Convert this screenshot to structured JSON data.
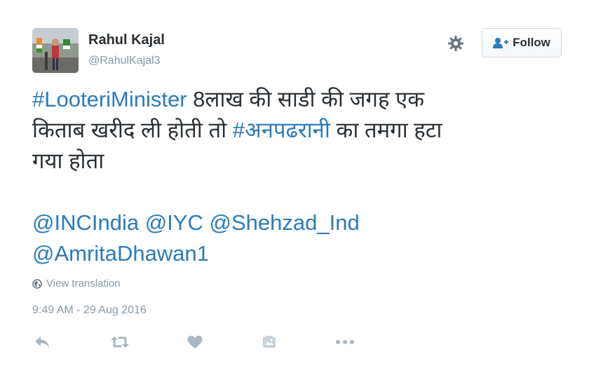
{
  "user": {
    "full_name": "Rahul Kajal",
    "handle": "@RahulKajal3"
  },
  "follow_label": "Follow",
  "tweet": {
    "line1_hashtag": "#LooteriMinister",
    "line1_rest": " 8लाख की साडी की जगह एक",
    "line2_start": "किताब खरीद ली होती तो ",
    "line2_hashtag": "#अनपढरानी",
    "line2_end": " का तमगा हटा",
    "line3": "गया होता",
    "mentions": [
      "@INCIndia",
      "@IYC",
      "@Shehzad_Ind",
      "@AmritaDhawan1"
    ]
  },
  "view_translation": "View translation",
  "timestamp": "9:49 AM - 29 Aug 2016",
  "colors": {
    "link": "#2b7bb9",
    "muted": "#8899a6",
    "text": "#292f33",
    "icon": "#aab8c2"
  },
  "icons": [
    "gear-icon",
    "follow-user-icon",
    "globe-icon",
    "reply-icon",
    "retweet-icon",
    "like-icon",
    "moment-icon",
    "more-icon"
  ]
}
